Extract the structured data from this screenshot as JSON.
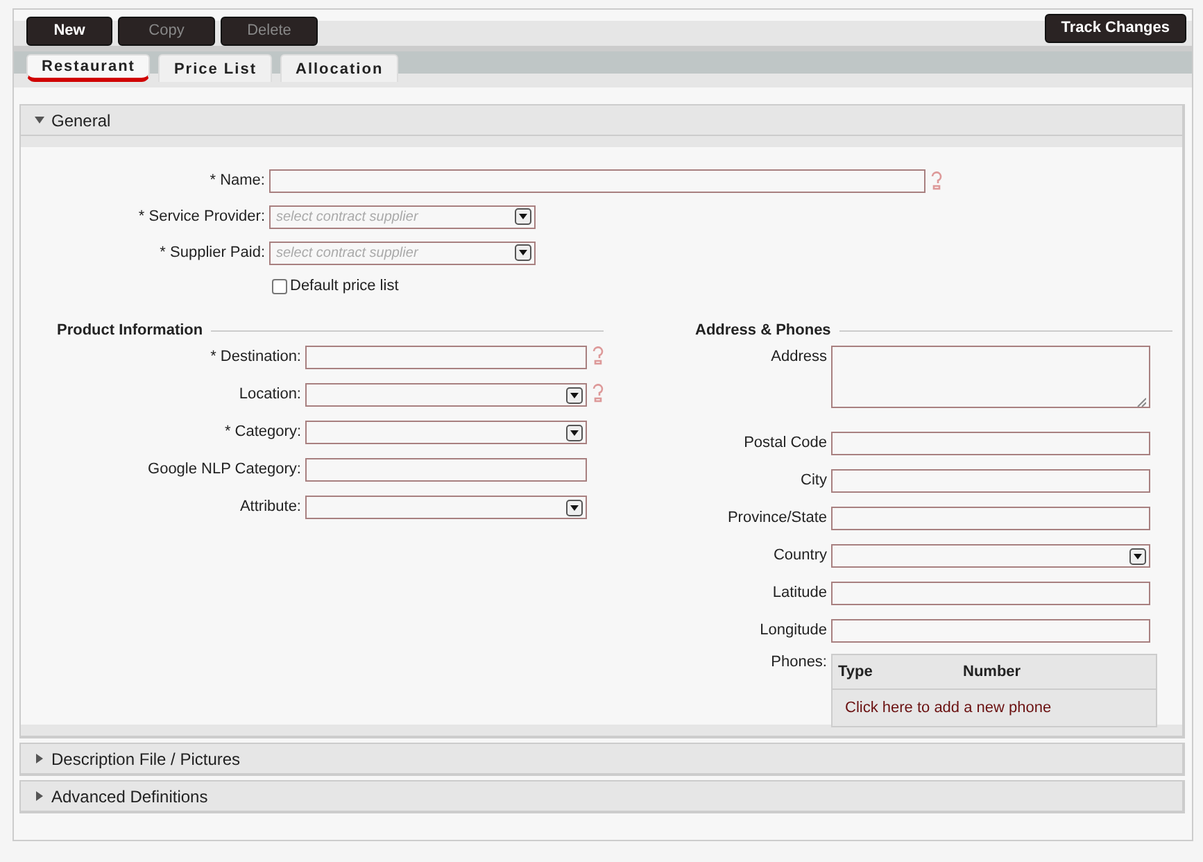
{
  "toolbar": {
    "buttons": [
      {
        "label": "New",
        "disabled": false
      },
      {
        "label": "Copy",
        "disabled": true
      },
      {
        "label": "Delete",
        "disabled": true
      }
    ],
    "track_button": "Track Changes"
  },
  "tabs": [
    {
      "label": "Restaurant",
      "selected": true
    },
    {
      "label": "Price List",
      "selected": false
    },
    {
      "label": "Allocation",
      "selected": false
    }
  ],
  "sections": [
    {
      "title": "General",
      "expanded": true,
      "general_fields": [
        {
          "label": "* Name:",
          "kind": "text",
          "help": true
        },
        {
          "label": "* Service Provider:",
          "kind": "select",
          "placeholder": "select contract supplier",
          "help": false
        },
        {
          "label": "* Supplier Paid:",
          "kind": "select",
          "placeholder": "select contract supplier",
          "help": false
        }
      ],
      "default_price_list": {
        "label": "Default price list",
        "checked": false
      },
      "groups": [
        {
          "title": "Product Information",
          "fields": [
            {
              "label": "* Destination:",
              "kind": "text",
              "help": true
            },
            {
              "label": "Location:",
              "kind": "select",
              "help": true
            },
            {
              "label": "* Category:",
              "kind": "select",
              "help": false
            },
            {
              "label": "Google NLP Category:",
              "kind": "text",
              "help": false
            },
            {
              "label": "Attribute:",
              "kind": "select",
              "help": false
            }
          ]
        },
        {
          "title": "Address & Phones",
          "fields": [
            {
              "label": "Address",
              "kind": "textarea",
              "help": false
            },
            {
              "label": "Postal Code",
              "kind": "text",
              "help": false
            },
            {
              "label": "City",
              "kind": "text",
              "help": false
            },
            {
              "label": "Province/State",
              "kind": "text",
              "help": false
            },
            {
              "label": "Country",
              "kind": "select",
              "help": false
            },
            {
              "label": "Latitude",
              "kind": "text",
              "help": false
            },
            {
              "label": "Longitude",
              "kind": "text",
              "help": false
            }
          ],
          "phones": {
            "label": "Phones:",
            "columns": [
              "Type",
              "Number"
            ],
            "add_link": "Click here to add a new phone"
          }
        }
      ]
    },
    {
      "title": "Description File / Pictures",
      "expanded": false
    },
    {
      "title": "Advanced Definitions",
      "expanded": false
    }
  ]
}
